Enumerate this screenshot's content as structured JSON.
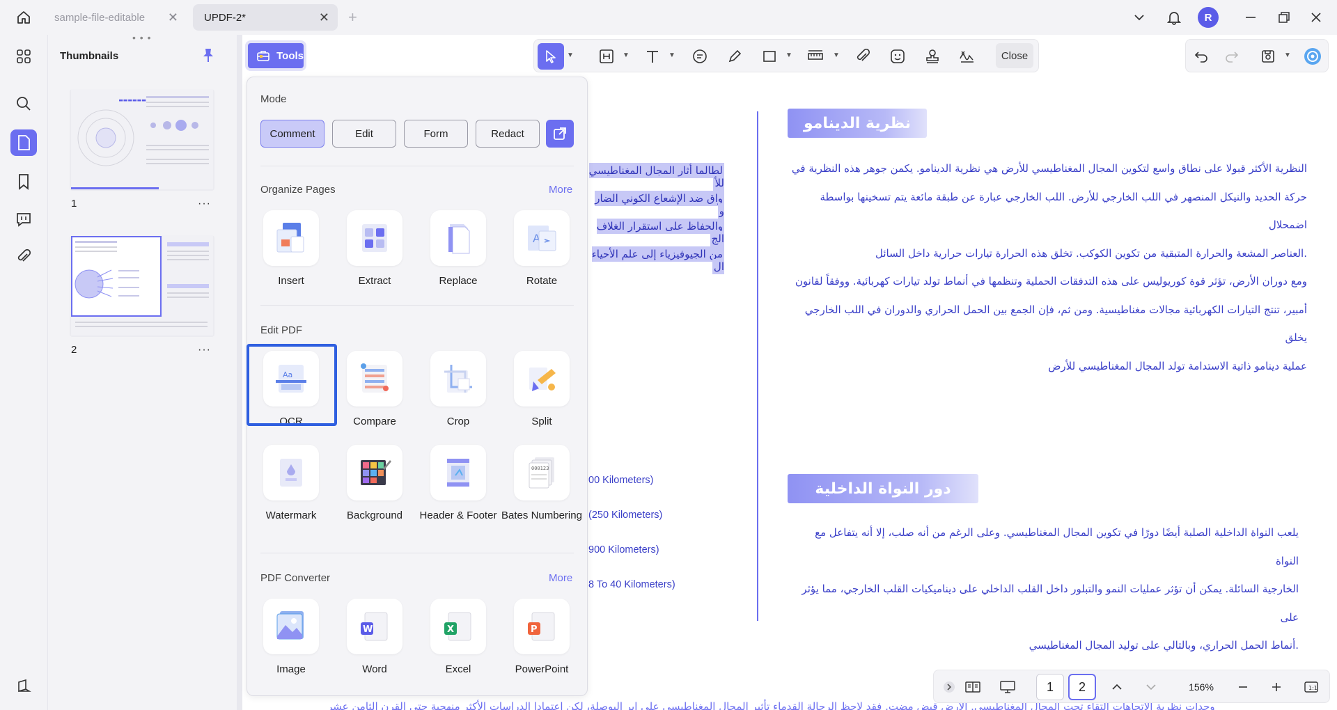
{
  "tabs": [
    {
      "label": "sample-file-editable",
      "active": false
    },
    {
      "label": "UPDF-2*",
      "active": true
    }
  ],
  "user": {
    "avatar_initial": "R"
  },
  "thumbnails": {
    "title": "Thumbnails",
    "pages": [
      {
        "label": "1"
      },
      {
        "label": "2"
      }
    ],
    "more_glyph": "···"
  },
  "tools_button": {
    "label": "Tools"
  },
  "tools_panel": {
    "mode": {
      "title": "Mode",
      "buttons": [
        "Comment",
        "Edit",
        "Form",
        "Redact"
      ],
      "active": "Comment"
    },
    "organize": {
      "title": "Organize Pages",
      "more": "More",
      "items": [
        "Insert",
        "Extract",
        "Replace",
        "Rotate"
      ]
    },
    "edit_pdf": {
      "title": "Edit PDF",
      "items": [
        "OCR",
        "Compare",
        "Crop",
        "Split",
        "Watermark",
        "Background",
        "Header & Footer",
        "Bates Numbering"
      ],
      "selected": "OCR"
    },
    "converter": {
      "title": "PDF Converter",
      "more": "More",
      "items": [
        "Image",
        "Word",
        "Excel",
        "PowerPoint"
      ]
    }
  },
  "toolbar": {
    "close_label": "Close"
  },
  "document": {
    "heading1": "نظرية الدينامو",
    "para1": [
      "النظرية الأكثر قبولا على نطاق واسع لتكوين المجال المغناطيسي للأرض هي نظرية الدينامو. يكمن جوهر هذه النظرية في",
      "حركة الحديد والنيكل المنصهر في اللب الخارجي للأرض. اللب الخارجي عبارة عن طبقة مائعة يتم تسخينها بواسطة اضمحلال",
      ".العناصر المشعة والحرارة المتبقية من تكوين الكوكب. تخلق هذه الحرارة تيارات حرارية داخل السائل",
      "ومع دوران الأرض، تؤثر قوة كوريوليس على هذه التدفقات الحملية وتنظمها في أنماط تولد تيارات كهربائية. ووفقاً لقانون",
      "أمبير، تنتج التيارات الكهربائية مجالات مغناطيسية. ومن ثم، فإن الجمع بين الحمل الحراري والدوران في اللب الخارجي يخلق",
      "عملية دينامو ذاتية الاستدامة تولد المجال المغناطيسي للأرض"
    ],
    "heading2": "دور النواة الداخلية",
    "para2": [
      "يلعب النواة الداخلية الصلبة أيضًا دورًا في تكوين المجال المغناطيسي. وعلى الرغم من أنه صلب، إلا أنه يتفاعل مع النواة",
      "الخارجية السائلة. يمكن أن تؤثر عمليات النمو والتبلور داخل القلب الداخلي على ديناميكيات القلب الخارجي، مما يؤثر على",
      ".أنماط الحمل الحراري، وبالتالي على توليد المجال المغناطيسي"
    ],
    "left_highlight": [
      "لطالما أثار المجال المغناطيسي للأ",
      "واق ضد الإشعاع الكوني الضار و",
      "والحفاظ على استقرار الغلاف الج",
      "من الجيوفيزياء إلى علم الأحياء ال"
    ],
    "km_labels": [
      "00 Kilometers)",
      "(250 Kilometers)",
      "900 Kilometers)",
      "8 To 40 Kilometers)"
    ],
    "bottom_text": "وحدات نظرية الإتجاهات التقاء تحت المجال المغناطيسي. الأرض قبض مضت. فقد لاحظ الرحالة القدماء تأثير المجال المغناطيسي على إبر البوصلة، لكن اعتمادا الدراسات الأكثر منهجية حتى القرن الثامن عشر"
  },
  "pagination": {
    "pages": [
      "1",
      "2"
    ],
    "current": "2",
    "zoom": "156%"
  },
  "colors": {
    "accent": "#6b6ef0",
    "text_blue": "#3a3fc8",
    "selection": "#c7c8f6"
  }
}
